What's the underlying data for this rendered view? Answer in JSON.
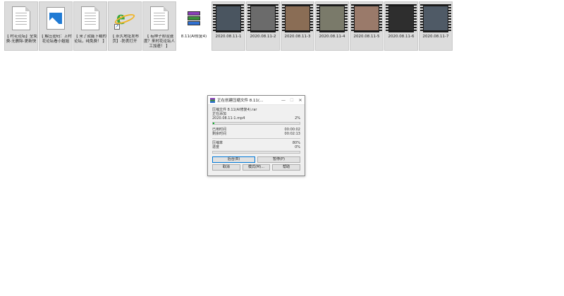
{
  "desktop": {
    "files": [
      {
        "label": "【 村花论坛】全免费-无删除-更新快",
        "kind": "doc"
      },
      {
        "label": "【 解压密码：上村花论坛看小姐姐",
        "kind": "image"
      },
      {
        "label": "【 来了就能下载的论坛，纯免费！ 】",
        "kind": "doc"
      },
      {
        "label": "【 永久地址发布页】-防丢打开",
        "kind": "ie-shortcut"
      },
      {
        "label": "【 有种子却没速度？来村花论坛人工加速！ 】",
        "kind": "doc"
      },
      {
        "label": "8.11(AI修复4)",
        "kind": "rar"
      },
      {
        "label": "2020.08.11-1",
        "kind": "video",
        "color": "#4a5560"
      },
      {
        "label": "2020.08.11-2",
        "kind": "video",
        "color": "#6b6b6b"
      },
      {
        "label": "2020.08.11-3",
        "kind": "video",
        "color": "#8a6d55"
      },
      {
        "label": "2020.08.11-4",
        "kind": "video",
        "color": "#7a7a6a"
      },
      {
        "label": "2020.08.11-5",
        "kind": "video",
        "color": "#9a7a6a"
      },
      {
        "label": "2020.08.11-6",
        "kind": "video",
        "color": "#2e2e2e"
      },
      {
        "label": "2020.08.11-7",
        "kind": "video",
        "color": "#4f5a66"
      }
    ]
  },
  "dialog": {
    "title": "正在创建压缩文件 8.11(…",
    "minimize": "—",
    "maximize": "☐",
    "close": "✕",
    "archive_line": "压缩文件 8.11(AI修复4).rar",
    "adding_label": "正在添加",
    "current_file": "2020.08.11-1.mp4",
    "current_percent": "2%",
    "current_progress": 0.02,
    "elapsed_label": "已用时间",
    "elapsed_value": "00:00:02",
    "remaining_label": "剩余时间",
    "remaining_value": "00:02:13",
    "ratio_label": "压缩率",
    "ratio_value": "80%",
    "progress_label": "进度",
    "progress_value": "0%",
    "total_progress": 0.0,
    "buttons": {
      "background": "后台(B)",
      "pause": "暂停(P)",
      "cancel": "取消",
      "mode": "模式(M)...",
      "help": "帮助"
    },
    "accent_color": "#06b025"
  }
}
